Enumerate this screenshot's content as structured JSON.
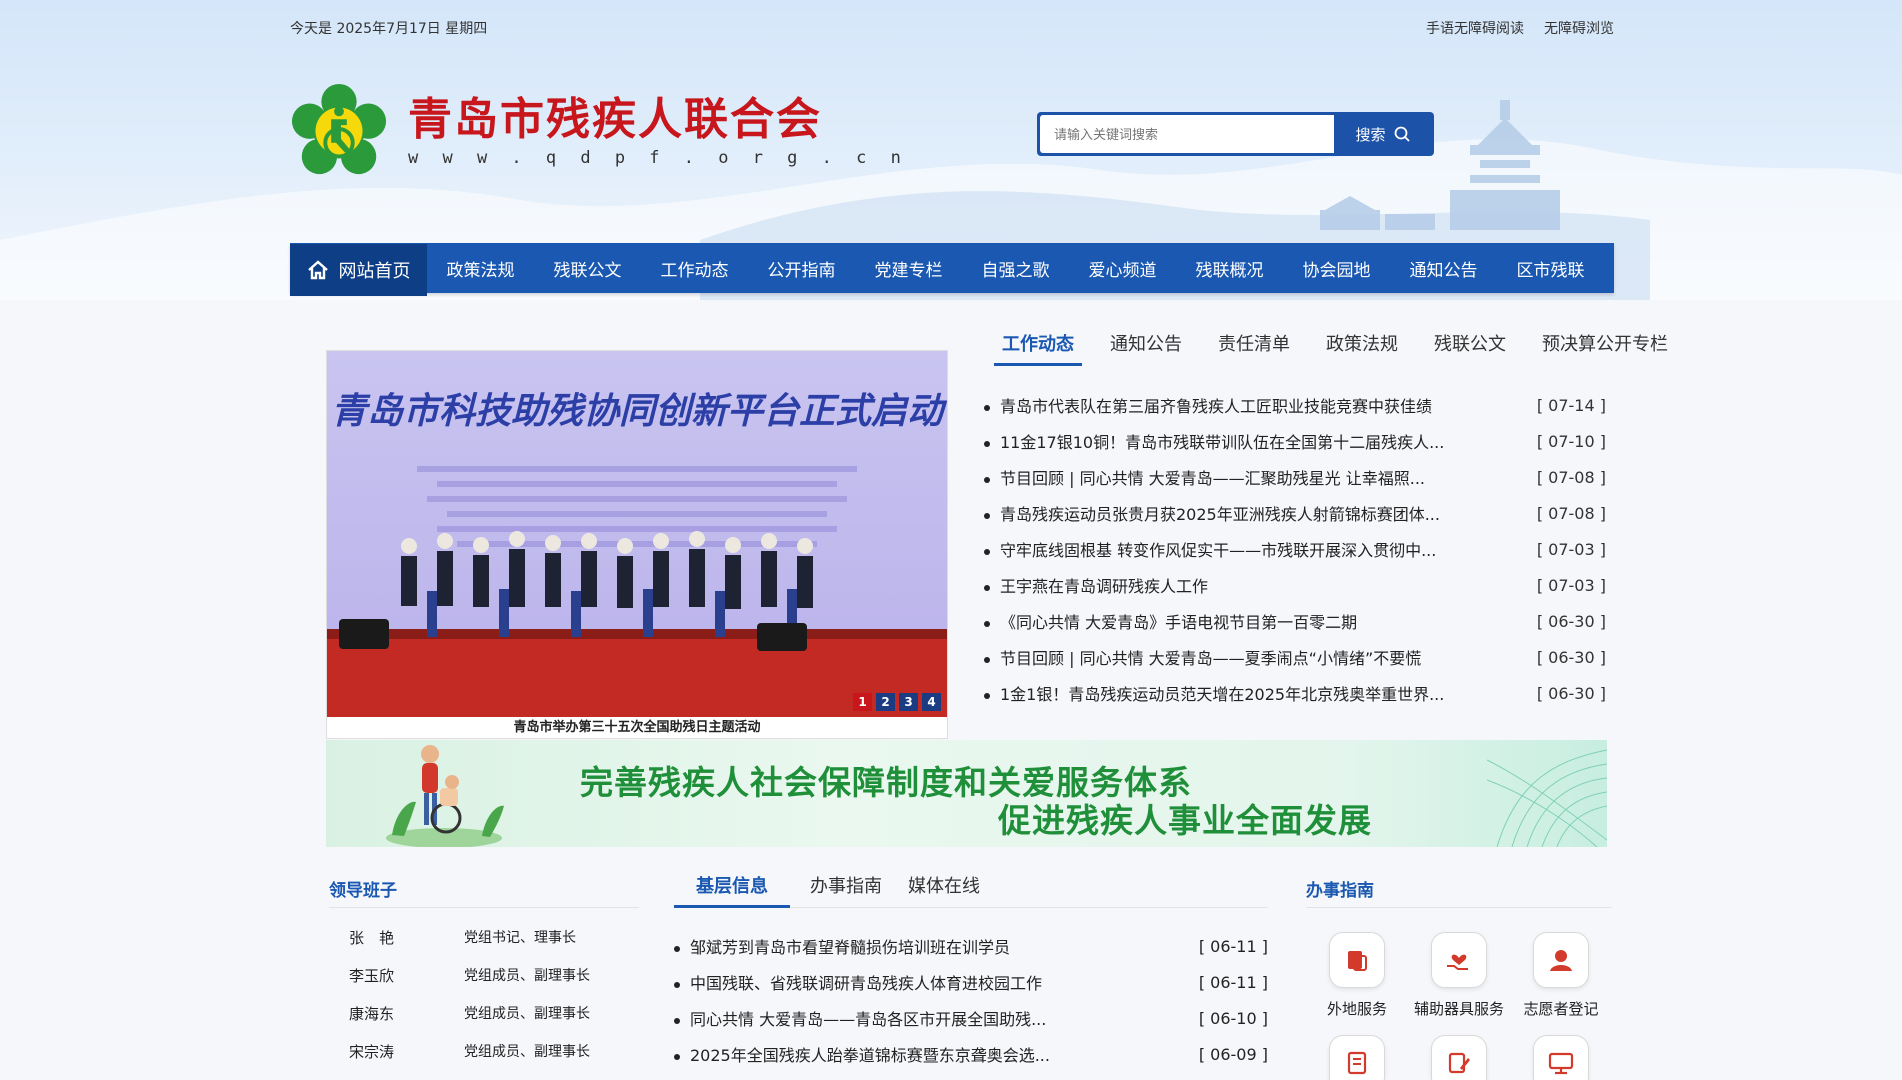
{
  "topbar": {
    "date": "今天是 2025年7月17日 星期四",
    "sign_reading": "手语无障碍阅读",
    "accessible_browse": "无障碍浏览"
  },
  "site": {
    "name": "青岛市残疾人联合会",
    "url": "w w w . q d p f . o r g . c n"
  },
  "search": {
    "placeholder": "请输入关键词搜索",
    "button": "搜索"
  },
  "nav": {
    "home": "网站首页",
    "items": [
      "政策法规",
      "残联公文",
      "工作动态",
      "公开指南",
      "党建专栏",
      "自强之歌",
      "爱心频道",
      "残联概况",
      "协会园地",
      "通知公告",
      "区市残联"
    ]
  },
  "slideshow": {
    "headline": "青岛市科技助残协同创新平台正式启动",
    "caption": "青岛市举办第三十五次全国助残日主题活动",
    "pages": [
      "1",
      "2",
      "3",
      "4"
    ],
    "active_page": 1
  },
  "news": {
    "tabs": [
      "工作动态",
      "通知公告",
      "责任清单",
      "政策法规",
      "残联公文",
      "预决算公开专栏"
    ],
    "active_tab": 0,
    "items": [
      {
        "title": "青岛市代表队在第三届齐鲁残疾人工匠职业技能竞赛中获佳绩",
        "date": "[ 07-14 ]"
      },
      {
        "title": "11金17银10铜！青岛市残联带训队伍在全国第十二届残疾人...",
        "date": "[ 07-10 ]"
      },
      {
        "title": "节目回顾 | 同心共情 大爱青岛——汇聚助残星光 让幸福照...",
        "date": "[ 07-08 ]"
      },
      {
        "title": "青岛残疾运动员张贵月获2025年亚洲残疾人射箭锦标赛团体...",
        "date": "[ 07-08 ]"
      },
      {
        "title": "守牢底线固根基 转变作风促实干——市残联开展深入贯彻中...",
        "date": "[ 07-03 ]"
      },
      {
        "title": "王宇燕在青岛调研残疾人工作",
        "date": "[ 07-03 ]"
      },
      {
        "title": "《同心共情 大爱青岛》手语电视节目第一百零二期",
        "date": "[ 06-30 ]"
      },
      {
        "title": "节目回顾 | 同心共情 大爱青岛——夏季闹点“小情绪”不要慌",
        "date": "[ 06-30 ]"
      },
      {
        "title": "1金1银！青岛残疾运动员范天增在2025年北京残奥举重世界...",
        "date": "[ 06-30 ]"
      }
    ]
  },
  "banner": {
    "line1": "完善残疾人社会保障制度和关爱服务体系",
    "line2": "促进残疾人事业全面发展"
  },
  "leaders": {
    "title": "领导班子",
    "rows": [
      {
        "name": "张　艳",
        "position": "党组书记、理事长"
      },
      {
        "name": "李玉欣",
        "position": "党组成员、副理事长"
      },
      {
        "name": "康海东",
        "position": "党组成员、副理事长"
      },
      {
        "name": "宋宗涛",
        "position": "党组成员、副理事长"
      }
    ]
  },
  "grassroots": {
    "tabs": [
      "基层信息",
      "办事指南",
      "媒体在线"
    ],
    "active_tab": 0,
    "items": [
      {
        "title": "邹斌芳到青岛市看望脊髓损伤培训班在训学员",
        "date": "[ 06-11 ]"
      },
      {
        "title": "中国残联、省残联调研青岛残疾人体育进校园工作",
        "date": "[ 06-11 ]"
      },
      {
        "title": "同心共情 大爱青岛——青岛各区市开展全国助残...",
        "date": "[ 06-10 ]"
      },
      {
        "title": "2025年全国残疾人跆拳道锦标赛暨东京聋奥会选...",
        "date": "[ 06-09 ]"
      }
    ]
  },
  "guide": {
    "title": "办事指南",
    "items": [
      {
        "label": "外地服务",
        "icon": "clipboard-icon"
      },
      {
        "label": "辅助器具服务",
        "icon": "hand-heart-icon"
      },
      {
        "label": "志愿者登记",
        "icon": "volunteer-icon"
      },
      {
        "label": "",
        "icon": "document-icon"
      },
      {
        "label": "",
        "icon": "edit-icon"
      },
      {
        "label": "",
        "icon": "monitor-icon"
      }
    ]
  },
  "colors": {
    "brand_blue": "#1a58b1",
    "nav_home": "#0e3e86",
    "logo_red": "#c8161d",
    "banner_green": "#1f8f3a"
  }
}
